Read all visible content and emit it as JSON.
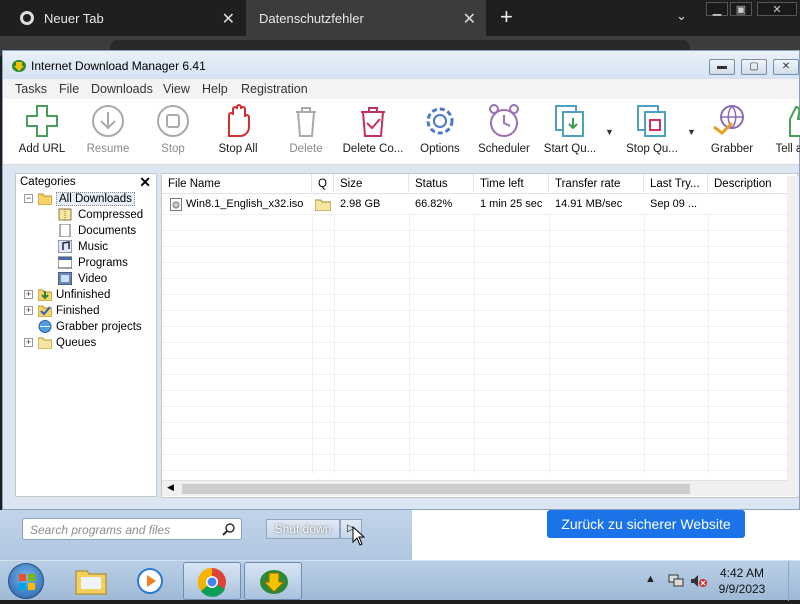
{
  "browser": {
    "tabs": [
      {
        "label": "Neuer Tab"
      },
      {
        "label": "Datenschutzfehler"
      }
    ],
    "back_button_label": "Zurück zu sicherer Website"
  },
  "idm": {
    "title": "Internet Download Manager 6.41",
    "menu": [
      "Tasks",
      "File",
      "Downloads",
      "View",
      "Help",
      "Registration"
    ],
    "toolbar": [
      {
        "label": "Add URL",
        "icon": "add-url-icon",
        "enabled": true
      },
      {
        "label": "Resume",
        "icon": "resume-icon",
        "enabled": false
      },
      {
        "label": "Stop",
        "icon": "stop-icon",
        "enabled": false
      },
      {
        "label": "Stop All",
        "icon": "stop-all-icon",
        "enabled": true
      },
      {
        "label": "Delete",
        "icon": "delete-icon",
        "enabled": false
      },
      {
        "label": "Delete Co...",
        "icon": "delete-completed-icon",
        "enabled": true
      },
      {
        "label": "Options",
        "icon": "options-icon",
        "enabled": true
      },
      {
        "label": "Scheduler",
        "icon": "scheduler-icon",
        "enabled": true
      },
      {
        "label": "Start Qu...",
        "icon": "start-queue-icon",
        "enabled": true
      },
      {
        "label": "Stop Qu...",
        "icon": "stop-queue-icon",
        "enabled": true
      },
      {
        "label": "Grabber",
        "icon": "grabber-icon",
        "enabled": true
      },
      {
        "label": "Tell a F",
        "icon": "tell-friend-icon",
        "enabled": true
      }
    ],
    "categories": {
      "header": "Categories",
      "items": [
        {
          "label": "All Downloads",
          "selected": true
        },
        {
          "label": "Compressed"
        },
        {
          "label": "Documents"
        },
        {
          "label": "Music"
        },
        {
          "label": "Programs"
        },
        {
          "label": "Video"
        },
        {
          "label": "Unfinished"
        },
        {
          "label": "Finished"
        },
        {
          "label": "Grabber projects"
        },
        {
          "label": "Queues"
        }
      ]
    },
    "columns": [
      "File Name",
      "Q",
      "Size",
      "Status",
      "Time left",
      "Transfer rate",
      "Last Try...",
      "Description"
    ],
    "rows": [
      {
        "file_name": "Win8.1_English_x32.iso",
        "size": "2.98  GB",
        "status": "66.82%",
        "time_left": "1 min 25 sec",
        "rate": "14.91  MB/sec",
        "last_try": "Sep 09 ...",
        "description": ""
      }
    ]
  },
  "startmenu": {
    "search_placeholder": "Search programs and files",
    "shutdown_label": "Shut down"
  },
  "taskbar": {
    "time": "4:42 AM",
    "date": "9/9/2023"
  }
}
